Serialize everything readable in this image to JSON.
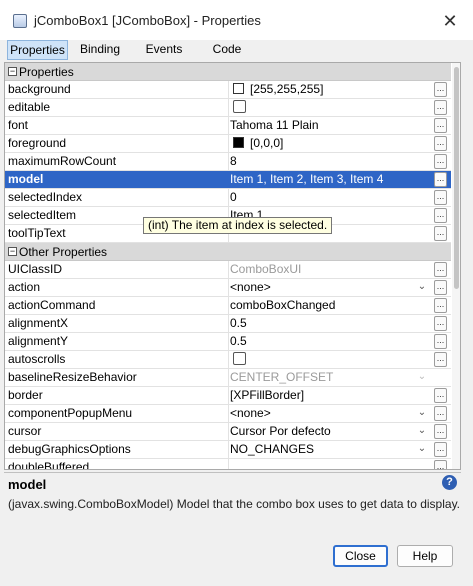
{
  "window": {
    "title": "jComboBox1 [JComboBox] - Properties",
    "close_glyph": "✕"
  },
  "tabs": [
    {
      "label": "Properties",
      "active": true
    },
    {
      "label": "Binding"
    },
    {
      "label": "Events"
    },
    {
      "label": "Code"
    }
  ],
  "sections": [
    {
      "label": "Properties",
      "toggle": "−",
      "rows": [
        {
          "name": "background",
          "value": "[255,255,255]",
          "swatch": "#ffffff"
        },
        {
          "name": "editable",
          "value": "",
          "checkbox": true
        },
        {
          "name": "font",
          "value": "Tahoma 11 Plain"
        },
        {
          "name": "foreground",
          "value": "[0,0,0]",
          "swatch": "#000000"
        },
        {
          "name": "maximumRowCount",
          "value": "8"
        },
        {
          "name": "model",
          "value": "Item 1, Item 2, Item 3, Item 4",
          "selected": true
        },
        {
          "name": "selectedIndex",
          "value": "0"
        },
        {
          "name": "selectedItem",
          "value": "Item 1"
        },
        {
          "name": "toolTipText",
          "value": ""
        }
      ]
    },
    {
      "label": "Other Properties",
      "toggle": "−",
      "rows": [
        {
          "name": "UIClassID",
          "value": "ComboBoxUI",
          "grey": true
        },
        {
          "name": "action",
          "value": "<none>",
          "dropdown": true
        },
        {
          "name": "actionCommand",
          "value": "comboBoxChanged"
        },
        {
          "name": "alignmentX",
          "value": "0.5"
        },
        {
          "name": "alignmentY",
          "value": "0.5"
        },
        {
          "name": "autoscrolls",
          "value": "",
          "checkbox": true
        },
        {
          "name": "baselineResizeBehavior",
          "value": "CENTER_OFFSET",
          "grey": true,
          "dropdown": true,
          "no_dots": true
        },
        {
          "name": "border",
          "value": "[XPFillBorder]"
        },
        {
          "name": "componentPopupMenu",
          "value": "<none>",
          "dropdown": true
        },
        {
          "name": "cursor",
          "value": "Cursor Por defecto",
          "dropdown": true
        },
        {
          "name": "debugGraphicsOptions",
          "value": "NO_CHANGES",
          "dropdown": true
        },
        {
          "name": "doubleBuffered",
          "value": ""
        }
      ]
    }
  ],
  "tooltip": "(int)  The item at index is selected.",
  "description": {
    "title": "model",
    "text": "(javax.swing.ComboBoxModel) Model that the combo box uses to get data to display.",
    "help_glyph": "?"
  },
  "buttons": {
    "close": "Close",
    "help": "Help"
  },
  "colors": {
    "selection": "#2e65c6",
    "section_header": "#d9d9d9",
    "tooltip_bg": "#ffffe1"
  }
}
